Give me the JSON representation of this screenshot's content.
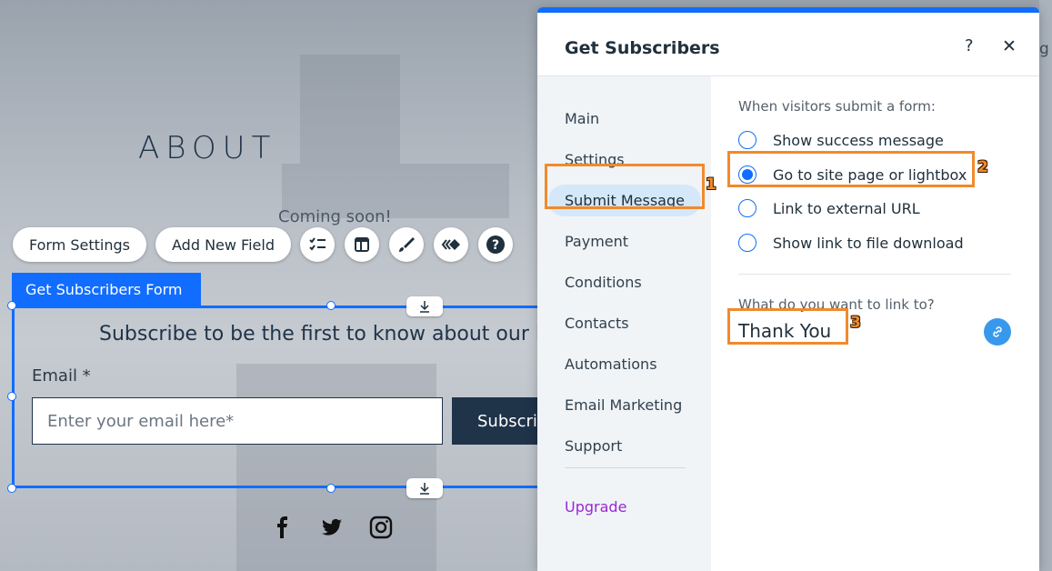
{
  "site": {
    "about_heading": "ABOUT",
    "coming_soon": "Coming soon!",
    "toolbar": {
      "form_settings": "Form Settings",
      "add_new_field": "Add New Field"
    },
    "form_tab_label": "Get Subscribers Form",
    "subscribe_text": "Subscribe to be the first to know about our laun",
    "email_label": "Email *",
    "email_placeholder": "Enter your email here*",
    "subscribe_button": "Subscrib",
    "edge_text": "g"
  },
  "panel": {
    "title": "Get Subscribers",
    "help": "?",
    "close": "✕",
    "nav": [
      {
        "label": "Main"
      },
      {
        "label": "Settings"
      },
      {
        "label": "Submit Message",
        "active": true
      },
      {
        "label": "Payment"
      },
      {
        "label": "Conditions"
      },
      {
        "label": "Contacts"
      },
      {
        "label": "Automations"
      },
      {
        "label": "Email Marketing"
      },
      {
        "label": "Support"
      }
    ],
    "upgrade": "Upgrade",
    "question": "When visitors submit a form:",
    "options": [
      {
        "label": "Show success message",
        "selected": false
      },
      {
        "label": "Go to site page or lightbox",
        "selected": true
      },
      {
        "label": "Link to external URL",
        "selected": false
      },
      {
        "label": "Show link to file download",
        "selected": false
      }
    ],
    "link_question": "What do you want to link to?",
    "link_value": "Thank You"
  },
  "annotations": [
    "1",
    "2",
    "3"
  ],
  "colors": {
    "accent": "#116dff",
    "annotation": "#f08a2c",
    "upgrade": "#9a27d5",
    "navy": "#1f3349"
  }
}
